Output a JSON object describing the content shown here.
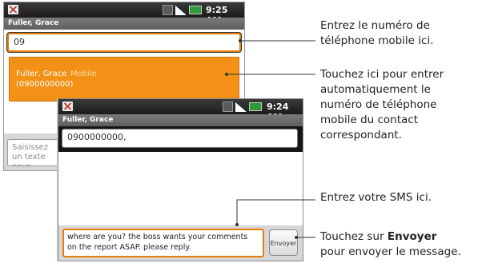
{
  "colors": {
    "accent_orange": "#f29116",
    "statusbar_dark": "#1c1c1c",
    "titlebar_gray": "#6b6b6b"
  },
  "phone_back": {
    "status_time": "9:25 AM",
    "title": "Fuller, Grace",
    "recipient_value": "09",
    "suggestion": {
      "name": "Fuller, Grace",
      "type": "Mobile",
      "number": "(0900000000)"
    },
    "compose_placeholder": "Saisissez un texte pour envoyer le message"
  },
  "phone_front": {
    "status_time": "9:24 AM",
    "title": "Fuller, Grace",
    "recipient_value": "0900000000,",
    "message_value": "where are you? the boss wants your comments on the report ASAP. please reply.",
    "send_label": "Envoyer"
  },
  "callouts": {
    "enter_number": "Entrez le numéro de téléphone mobile ici.",
    "tap_suggestion": "Touchez ici pour entrer automatiquement le numéro de téléphone mobile du contact correspondant.",
    "enter_sms": "Entrez votre SMS ici.",
    "tap_send_prefix": "Touchez sur ",
    "tap_send_bold": "Envoyer",
    "tap_send_suffix": "pour envoyer le message."
  }
}
